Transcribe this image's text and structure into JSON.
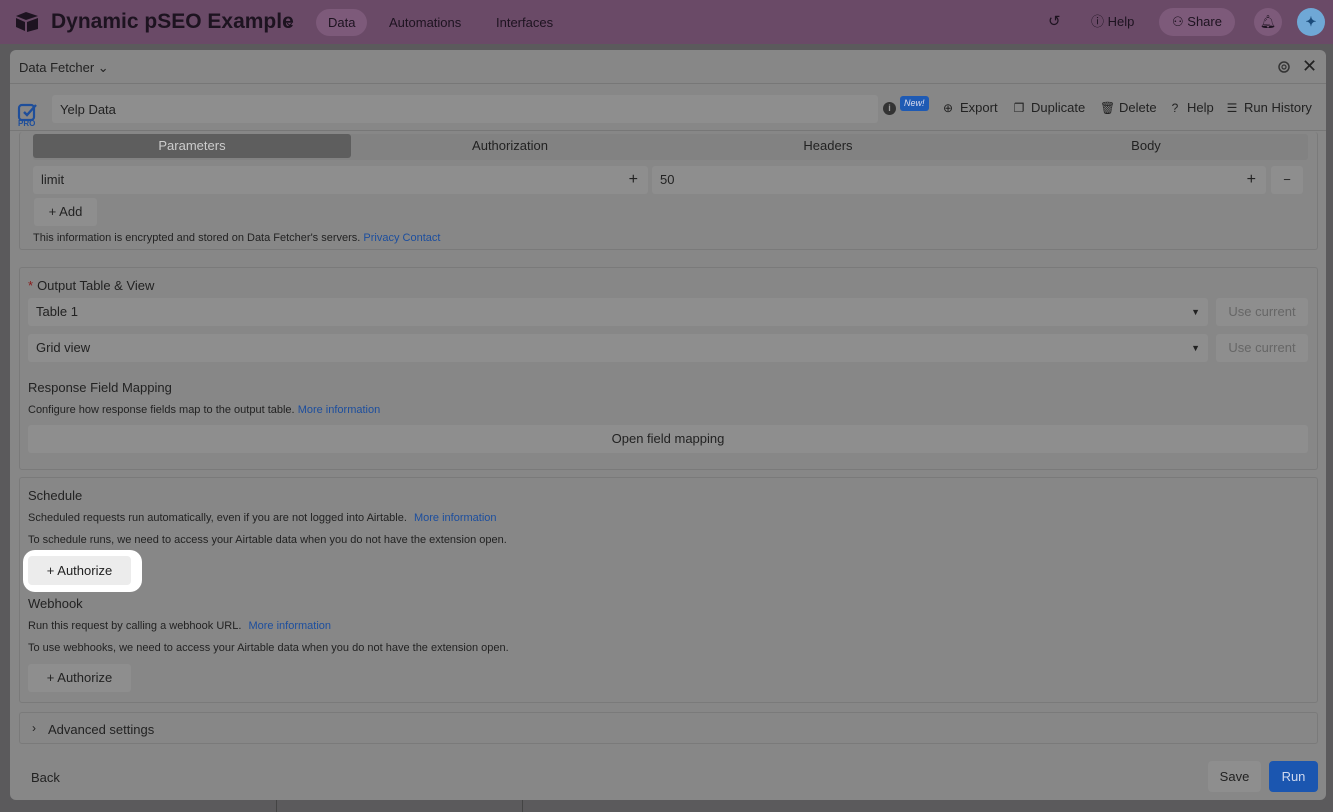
{
  "topbar": {
    "base_name": "Dynamic pSEO Example",
    "tabs": [
      {
        "label": "Data",
        "active": true
      },
      {
        "label": "Automations",
        "active": false
      },
      {
        "label": "Interfaces",
        "active": false
      }
    ],
    "help_label": "Help",
    "share_label": "Share"
  },
  "dialog": {
    "title": "Data Fetcher",
    "request_name": "Yelp Data",
    "pro_label": "PRO",
    "new_badge": "New!",
    "actions": {
      "export": "Export",
      "duplicate": "Duplicate",
      "delete": "Delete",
      "help": "Help",
      "run_history": "Run History"
    },
    "request_tabs": [
      {
        "label": "Parameters",
        "active": true
      },
      {
        "label": "Authorization",
        "active": false
      },
      {
        "label": "Headers",
        "active": false
      },
      {
        "label": "Body",
        "active": false
      }
    ],
    "param": {
      "key": "limit",
      "value": "50"
    },
    "add_label": "Add",
    "encrypted_note": "This information is encrypted and stored on Data Fetcher's servers.",
    "privacy_link": "Privacy",
    "contact_link": "Contact",
    "output": {
      "label": "Output Table & View",
      "table": "Table 1",
      "view": "Grid view",
      "use_current": "Use current"
    },
    "mapping": {
      "label": "Response Field Mapping",
      "desc": "Configure how response fields map to the output table.",
      "more_info": "More information",
      "button": "Open field mapping"
    },
    "schedule": {
      "label": "Schedule",
      "desc": "Scheduled requests run automatically, even if you are not logged into Airtable.",
      "more_info": "More information",
      "note": "To schedule runs, we need to access your Airtable data when you do not have the extension open.",
      "authorize": "Authorize"
    },
    "webhook": {
      "label": "Webhook",
      "desc": "Run this request by calling a webhook URL.",
      "more_info": "More information",
      "note": "To use webhooks, we need to access your Airtable data when you do not have the extension open.",
      "authorize": "Authorize"
    },
    "advanced_label": "Advanced settings",
    "footer": {
      "back": "Back",
      "save": "Save",
      "run": "Run"
    }
  },
  "colors": {
    "accent": "#1b56b0",
    "topbar": "#6a4a67",
    "overlay": "#878787"
  }
}
